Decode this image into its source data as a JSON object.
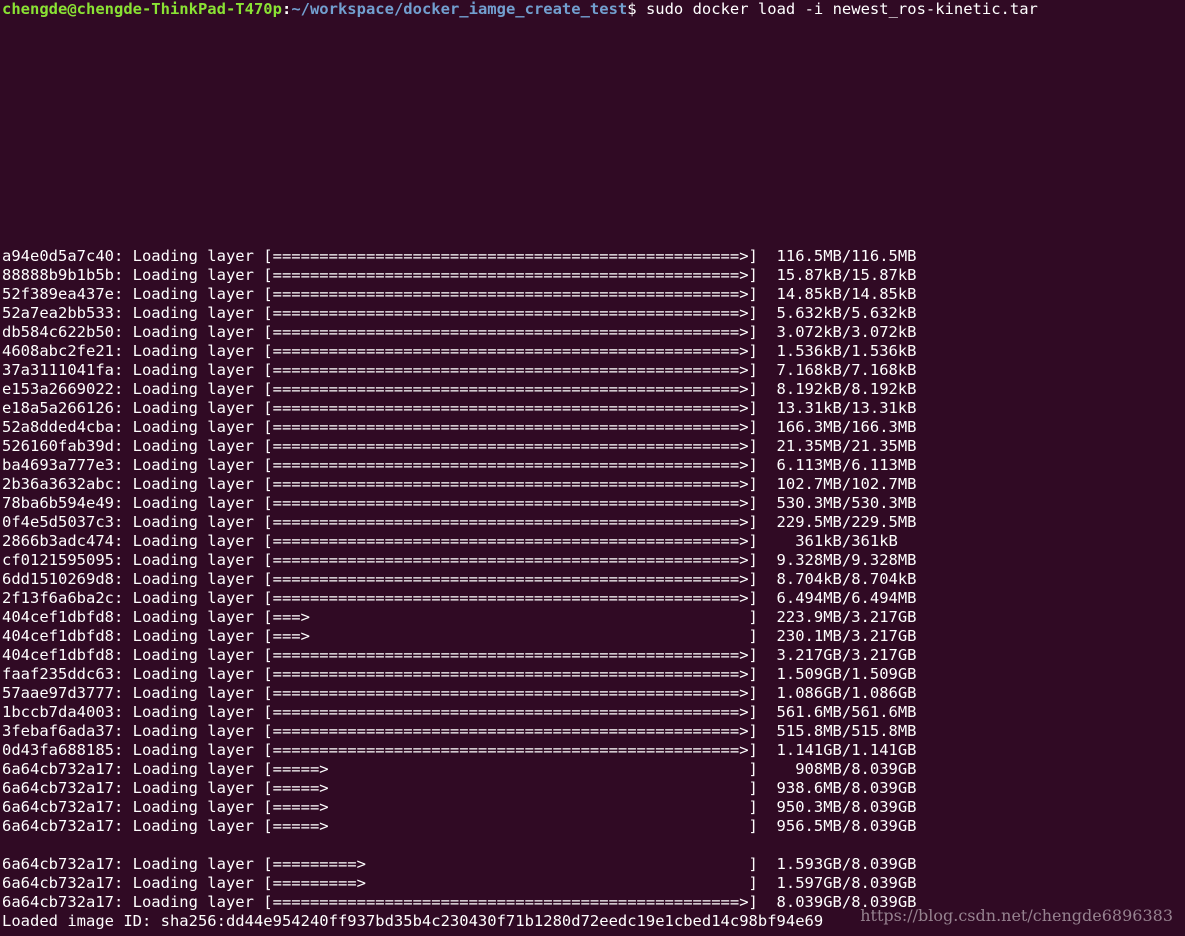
{
  "prompt": {
    "user_host": "chengde@chengde-ThinkPad-T470p",
    "colon": ":",
    "path": "~/workspace/docker_iamge_create_test",
    "symbol": "$",
    "command": " sudo docker load -i newest_ros-kinetic.tar"
  },
  "lines": [
    "a94e0d5a7c40: Loading layer [==================================================>]  116.5MB/116.5MB",
    "88888b9b1b5b: Loading layer [==================================================>]  15.87kB/15.87kB",
    "52f389ea437e: Loading layer [==================================================>]  14.85kB/14.85kB",
    "52a7ea2bb533: Loading layer [==================================================>]  5.632kB/5.632kB",
    "db584c622b50: Loading layer [==================================================>]  3.072kB/3.072kB",
    "4608abc2fe21: Loading layer [==================================================>]  1.536kB/1.536kB",
    "37a3111041fa: Loading layer [==================================================>]  7.168kB/7.168kB",
    "e153a2669022: Loading layer [==================================================>]  8.192kB/8.192kB",
    "e18a5a266126: Loading layer [==================================================>]  13.31kB/13.31kB",
    "52a8dded4cba: Loading layer [==================================================>]  166.3MB/166.3MB",
    "526160fab39d: Loading layer [==================================================>]  21.35MB/21.35MB",
    "ba4693a777e3: Loading layer [==================================================>]  6.113MB/6.113MB",
    "2b36a3632abc: Loading layer [==================================================>]  102.7MB/102.7MB",
    "78ba6b594e49: Loading layer [==================================================>]  530.3MB/530.3MB",
    "0f4e5d5037c3: Loading layer [==================================================>]  229.5MB/229.5MB",
    "2866b3adc474: Loading layer [==================================================>]    361kB/361kB",
    "cf0121595095: Loading layer [==================================================>]  9.328MB/9.328MB",
    "6dd1510269d8: Loading layer [==================================================>]  8.704kB/8.704kB",
    "2f13f6a6ba2c: Loading layer [==================================================>]  6.494MB/6.494MB",
    "404cef1dbfd8: Loading layer [===>                                               ]  223.9MB/3.217GB",
    "404cef1dbfd8: Loading layer [===>                                               ]  230.1MB/3.217GB",
    "404cef1dbfd8: Loading layer [==================================================>]  3.217GB/3.217GB",
    "faaf235ddc63: Loading layer [==================================================>]  1.509GB/1.509GB",
    "57aae97d3777: Loading layer [==================================================>]  1.086GB/1.086GB",
    "1bccb7da4003: Loading layer [==================================================>]  561.6MB/561.6MB",
    "3febaf6ada37: Loading layer [==================================================>]  515.8MB/515.8MB",
    "0d43fa688185: Loading layer [==================================================>]  1.141GB/1.141GB",
    "6a64cb732a17: Loading layer [=====>                                             ]    908MB/8.039GB",
    "6a64cb732a17: Loading layer [=====>                                             ]  938.6MB/8.039GB",
    "6a64cb732a17: Loading layer [=====>                                             ]  950.3MB/8.039GB",
    "6a64cb732a17: Loading layer [=====>                                             ]  956.5MB/8.039GB",
    "",
    "6a64cb732a17: Loading layer [=========>                                         ]  1.593GB/8.039GB",
    "6a64cb732a17: Loading layer [=========>                                         ]  1.597GB/8.039GB",
    "6a64cb732a17: Loading layer [==================================================>]  8.039GB/8.039GB",
    "Loaded image ID: sha256:dd44e954240ff937bd35b4c230430f71b1280d72eedc19e1cbed14c98bf94e69"
  ],
  "watermark": "https://blog.csdn.net/chengde6896383",
  "colors": {
    "background": "#300a24",
    "text": "#ffffff",
    "prompt_user": "#8ae234",
    "prompt_path": "#729fcf"
  }
}
